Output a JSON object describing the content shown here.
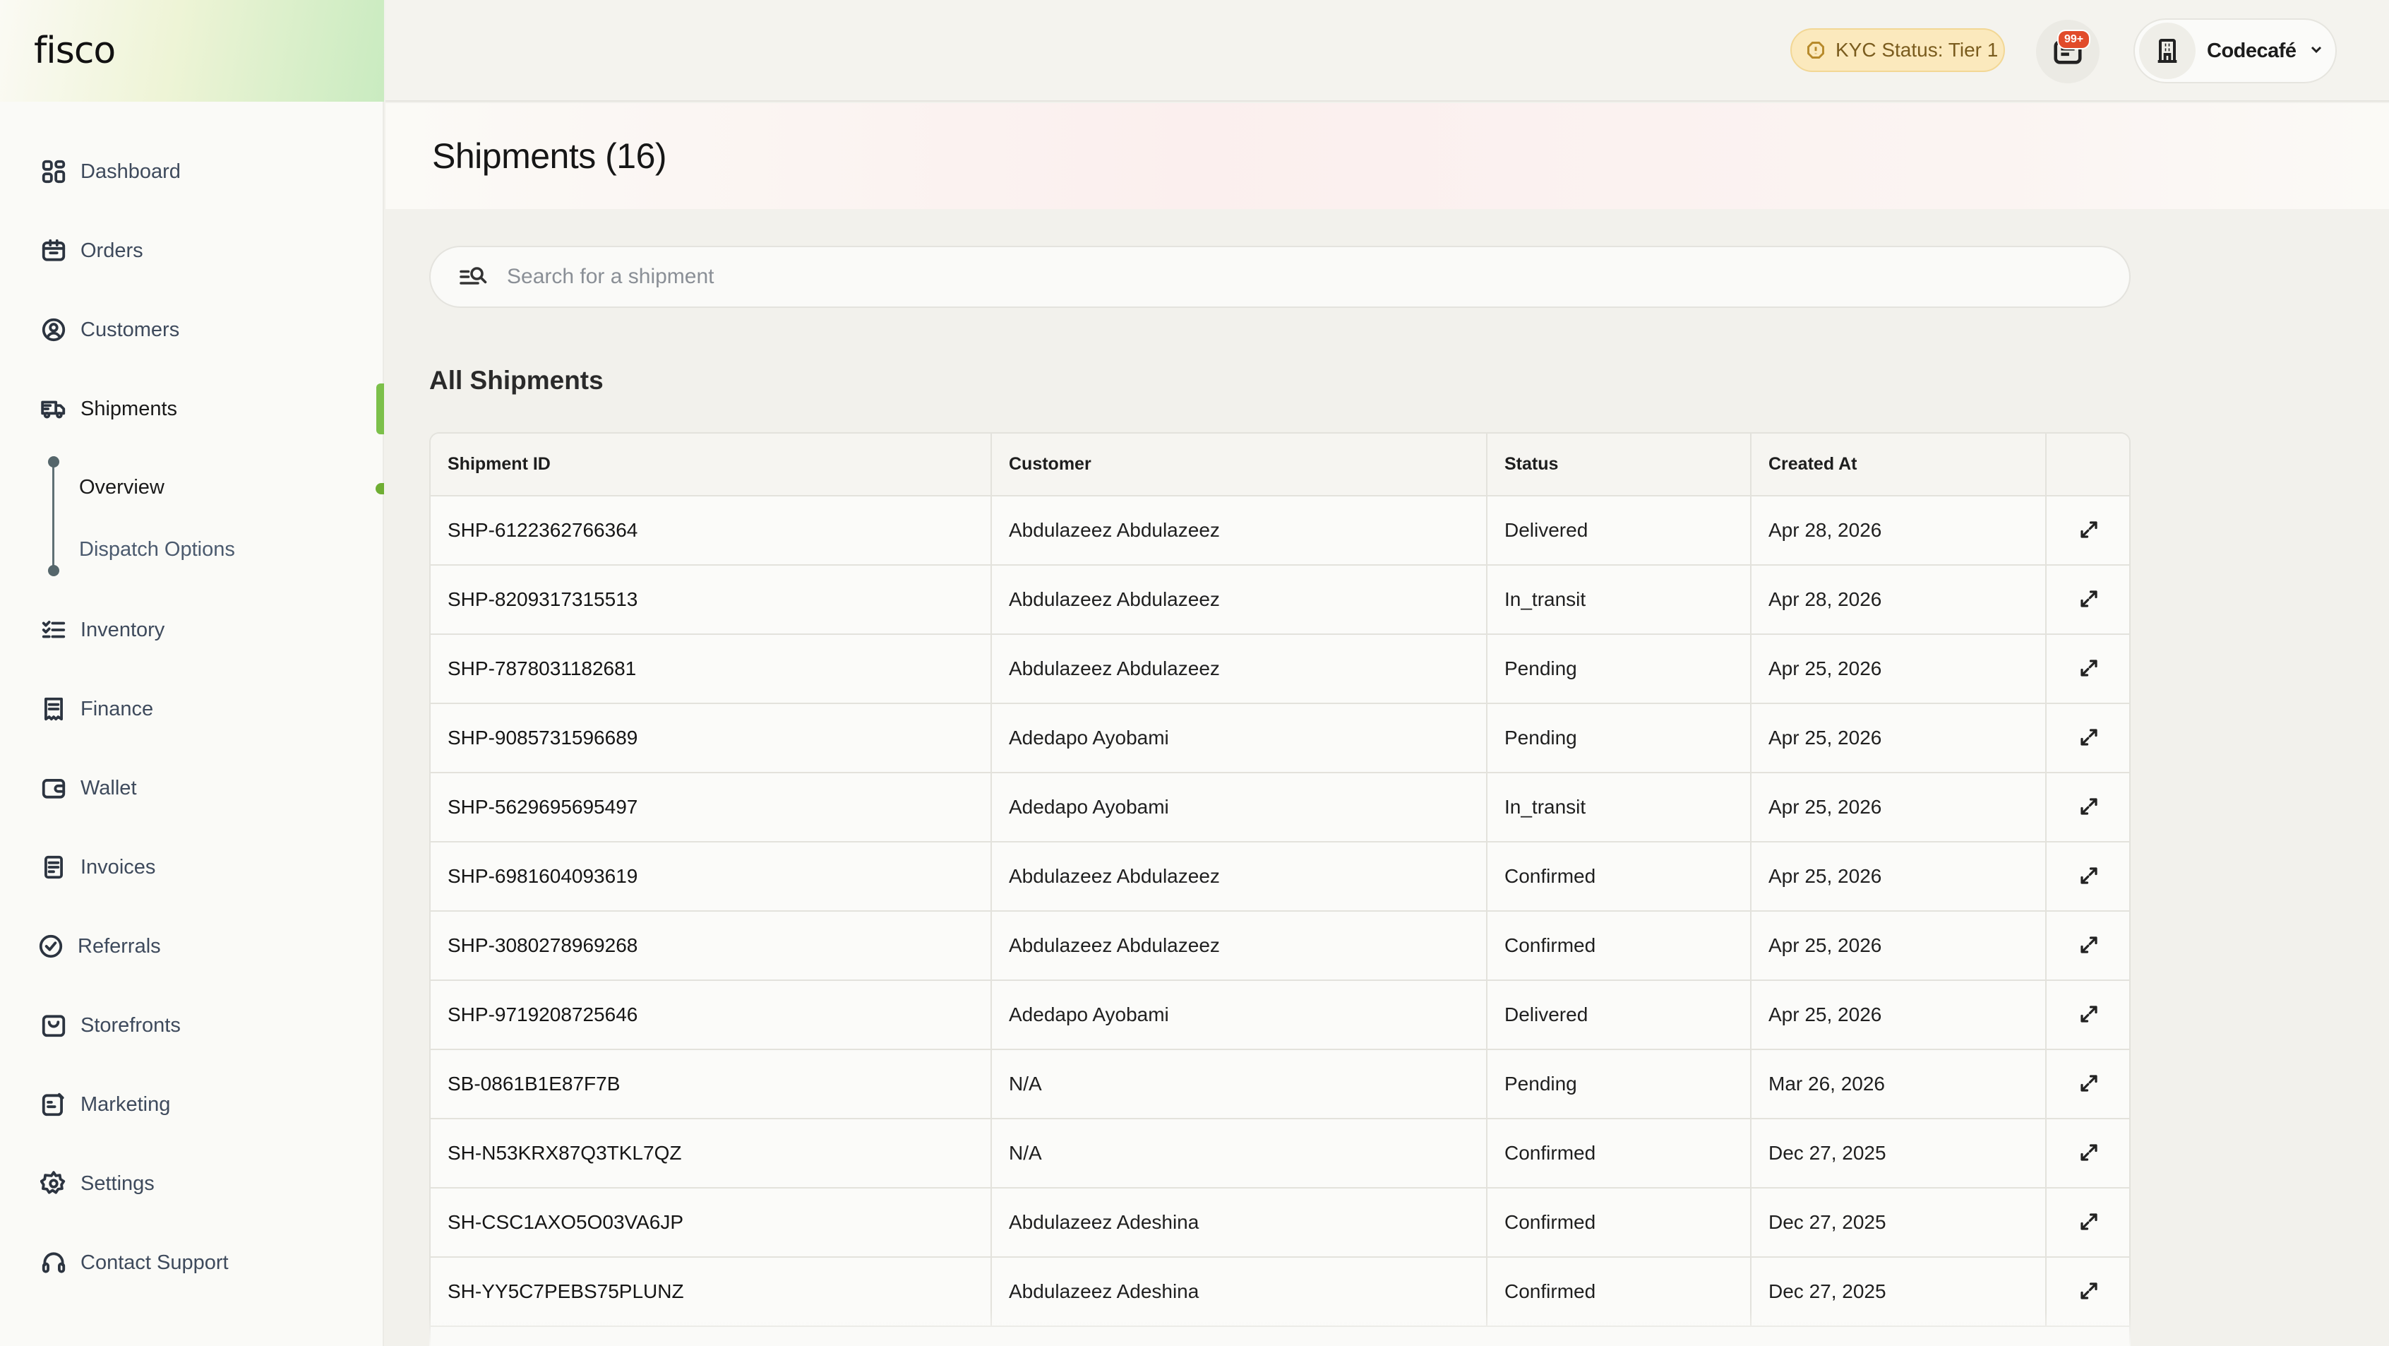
{
  "app": {
    "logo": "fisco"
  },
  "sidebar": {
    "items": [
      {
        "label": "Dashboard",
        "icon": "dashboard-icon"
      },
      {
        "label": "Orders",
        "icon": "orders-icon"
      },
      {
        "label": "Customers",
        "icon": "customers-icon"
      },
      {
        "label": "Shipments",
        "icon": "truck-icon",
        "active": true
      },
      {
        "label": "Inventory",
        "icon": "checklist-icon"
      },
      {
        "label": "Finance",
        "icon": "receipt-icon"
      },
      {
        "label": "Wallet",
        "icon": "wallet-icon"
      },
      {
        "label": "Invoices",
        "icon": "invoice-icon"
      },
      {
        "label": "Referrals",
        "icon": "badge-check-icon"
      },
      {
        "label": "Storefronts",
        "icon": "store-icon"
      },
      {
        "label": "Marketing",
        "icon": "megaphone-icon"
      },
      {
        "label": "Settings",
        "icon": "gear-icon"
      },
      {
        "label": "Contact Support",
        "icon": "headset-icon"
      }
    ],
    "shipments_sub": [
      {
        "label": "Overview",
        "active": true
      },
      {
        "label": "Dispatch Options"
      }
    ]
  },
  "topbar": {
    "kyc_label": "KYC Status: Tier 1",
    "notification_badge": "99+",
    "account_name": "Codecafé"
  },
  "main": {
    "page_title": "Shipments (16)",
    "search_placeholder": "Search for a shipment",
    "section_title": "All Shipments",
    "table": {
      "columns": [
        "Shipment ID",
        "Customer",
        "Status",
        "Created At",
        ""
      ],
      "rows": [
        {
          "id": "SHP-6122362766364",
          "customer": "Abdulazeez Abdulazeez",
          "status": "Delivered",
          "created": "Apr 28, 2026"
        },
        {
          "id": "SHP-8209317315513",
          "customer": "Abdulazeez Abdulazeez",
          "status": "In_transit",
          "created": "Apr 28, 2026"
        },
        {
          "id": "SHP-7878031182681",
          "customer": "Abdulazeez Abdulazeez",
          "status": "Pending",
          "created": "Apr 25, 2026"
        },
        {
          "id": "SHP-9085731596689",
          "customer": "Adedapo Ayobami",
          "status": "Pending",
          "created": "Apr 25, 2026"
        },
        {
          "id": "SHP-5629695695497",
          "customer": "Adedapo Ayobami",
          "status": "In_transit",
          "created": "Apr 25, 2026"
        },
        {
          "id": "SHP-6981604093619",
          "customer": "Abdulazeez Abdulazeez",
          "status": "Confirmed",
          "created": "Apr 25, 2026"
        },
        {
          "id": "SHP-3080278969268",
          "customer": "Abdulazeez Abdulazeez",
          "status": "Confirmed",
          "created": "Apr 25, 2026"
        },
        {
          "id": "SHP-9719208725646",
          "customer": "Adedapo Ayobami",
          "status": "Delivered",
          "created": "Apr 25, 2026"
        },
        {
          "id": "SB-0861B1E87F7B",
          "customer": "N/A",
          "status": "Pending",
          "created": "Mar 26, 2026"
        },
        {
          "id": "SH-N53KRX87Q3TKL7QZ",
          "customer": "N/A",
          "status": "Confirmed",
          "created": "Dec 27, 2025"
        },
        {
          "id": "SH-CSC1AXO5O03VA6JP",
          "customer": "Abdulazeez Adeshina",
          "status": "Confirmed",
          "created": "Dec 27, 2025"
        },
        {
          "id": "SH-YY5C7PEBS75PLUNZ",
          "customer": "Abdulazeez Adeshina",
          "status": "Confirmed",
          "created": "Dec 27, 2025"
        }
      ]
    }
  },
  "colors": {
    "accent": "#7cc04a",
    "kyc_bg": "#fbe9bd",
    "badge": "#e14b2b"
  }
}
